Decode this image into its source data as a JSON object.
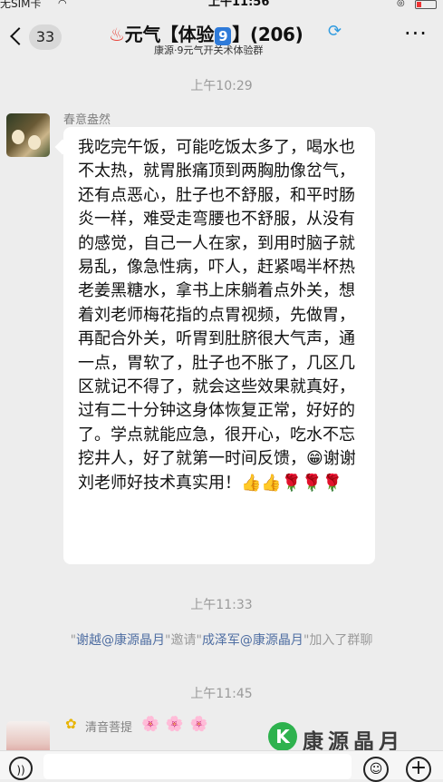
{
  "status_bar": {
    "carrier": "无SIM卡",
    "time": "上午11:56"
  },
  "header": {
    "unread_count": "33",
    "title_prefix": "元气【体验",
    "title_badge": "9",
    "title_suffix": "】(206)",
    "subtitle": "康源·9元气开关术体验群"
  },
  "messages": {
    "time_1": "上午10:29",
    "sender_1": "春意盎然",
    "text_1": "我吃完午饭，可能吃饭太多了，喝水也不太热，就胃胀痛顶到两胸肋像岔气，还有点恶心，肚子也不舒服，和平时肠炎一样，难受走弯腰也不舒服，从没有的感觉，自己一人在家，到用时脑子就易乱，像急性病，吓人，赶紧喝半杯热老姜黑糖水，拿书上床躺着点外关，想着刘老师梅花指的点胃视频，先做胃，再配合外关，听胃到肚脐很大气声，通一点，胃软了，肚子也不胀了，几区几区就记不得了，就会这些效果就真好，过有二十分钟这身体恢复正常，好好的了。学点就能应急，很开心，吃水不忘挖井人，好了就第一时间反馈，😁谢谢刘老师好技术真实用！👍👍🌹🌹🌹",
    "time_2": "上午11:33",
    "system_q1": "\"",
    "system_inviter": "谢越@康源晶月",
    "system_mid": "\"邀请\"",
    "system_invitee": "成泽军@康源晶月",
    "system_tail": "\"加入了群聊",
    "time_3": "上午11:45",
    "sender_2": "清音菩提",
    "sender_2_emojis": "🌸🌸🌸"
  },
  "watermark": {
    "logo_letter": "K",
    "text": "康源晶月"
  },
  "icons": {
    "accent": "#2f7bd9",
    "link": "#4f6ea2"
  }
}
